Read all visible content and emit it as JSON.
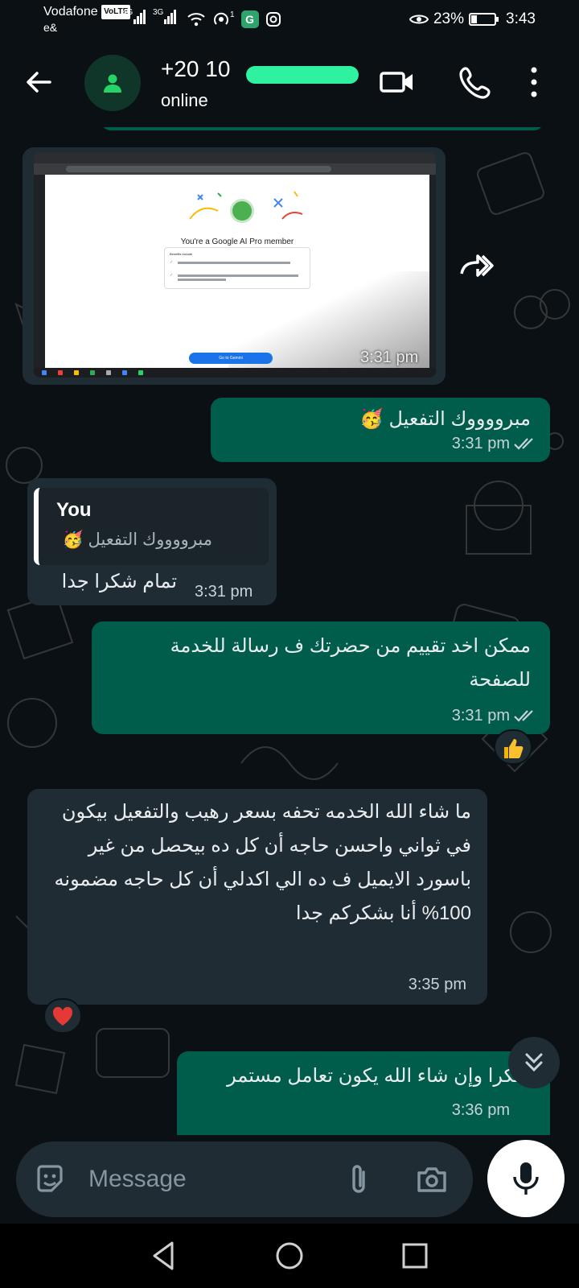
{
  "status_bar": {
    "carrier": "Vodafone",
    "volte": "VoLTE",
    "carrier2": "e&",
    "network1": "4G",
    "network2": "3G",
    "hotspot_count": "1",
    "battery": "23%",
    "time": "3:43"
  },
  "header": {
    "contact_name": "+20 10 ",
    "contact_status": "online"
  },
  "messages": {
    "image": {
      "page_title": "You're a Google AI Pro member",
      "benefits_label": "Benefits include",
      "cta": "Go to Gemini",
      "time": "3:31 pm"
    },
    "m1": {
      "text": "مبرووووك التفعيل 🥳",
      "time": "3:31 pm"
    },
    "m2": {
      "quote_author": "You",
      "quote_text": "مبرووووك التفعيل 🥳",
      "text": "تمام شكرا جدا",
      "time": "3:31 pm"
    },
    "m3": {
      "text": "ممكن اخد تقييم من حضرتك ف رسالة للخدمة للصفحة",
      "time": "3:31 pm"
    },
    "m4": {
      "text": "ما شاء الله الخدمه تحفه بسعر رهيب والتفعيل بيكون في ثواني واحسن حاجه أن كل ده بيحصل من غير  باسورد الايميل ف ده الي اكدلي أن  كل حاجه مضمونه 100% أنا بشكركم جدا",
      "time": "3:35 pm"
    },
    "m5": {
      "text": "شكرا وإن شاء الله يكون تعامل مستمر",
      "time": "3:36 pm"
    }
  },
  "composer": {
    "placeholder": "Message"
  },
  "colors": {
    "outgoing_bubble": "#005c4b",
    "incoming_bubble": "#202c33",
    "background": "#0b1014",
    "accent": "#25d366"
  }
}
